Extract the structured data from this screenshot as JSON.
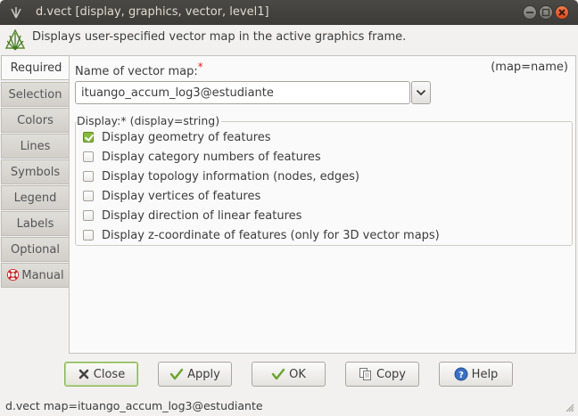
{
  "window": {
    "title": "d.vect [display, graphics, vector, level1]",
    "description": "Displays user-specified vector map in the active graphics frame."
  },
  "tabs": [
    {
      "label": "Required",
      "active": true
    },
    {
      "label": "Selection"
    },
    {
      "label": "Colors"
    },
    {
      "label": "Lines"
    },
    {
      "label": "Symbols"
    },
    {
      "label": "Legend"
    },
    {
      "label": "Labels"
    },
    {
      "label": "Optional"
    },
    {
      "label": "Manual",
      "icon": "lifebuoy-icon"
    }
  ],
  "map_field": {
    "label": "Name of vector map:",
    "required_mark": "*",
    "key": "(map=name)",
    "value": "ituango_accum_log3@estudiante"
  },
  "display_group": {
    "title": "Display:* (display=string)",
    "options": [
      {
        "label": "Display geometry of features",
        "checked": true
      },
      {
        "label": "Display category numbers of features",
        "checked": false
      },
      {
        "label": "Display topology information (nodes, edges)",
        "checked": false
      },
      {
        "label": "Display vertices of features",
        "checked": false
      },
      {
        "label": "Display direction of linear features",
        "checked": false
      },
      {
        "label": "Display z-coordinate of features (only for 3D vector maps)",
        "checked": false
      }
    ]
  },
  "buttons": {
    "close": "Close",
    "apply": "Apply",
    "ok": "OK",
    "copy": "Copy",
    "help": "Help"
  },
  "status": "d.vect map=ituango_accum_log3@estudiante",
  "colors": {
    "titlebar": "#3c3b37",
    "close_btn": "#df4a16",
    "check_green": "#87b93e"
  }
}
